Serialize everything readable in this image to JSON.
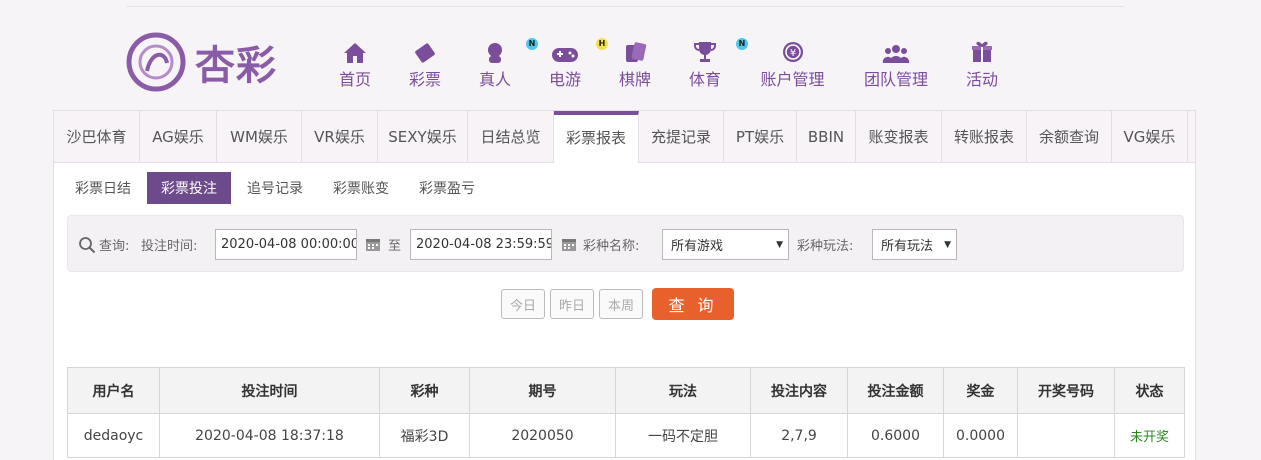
{
  "logo": {
    "text": "杏彩"
  },
  "nav": [
    {
      "label": "首页",
      "icon": "home-icon"
    },
    {
      "label": "彩票",
      "icon": "lottery-ticket-icon"
    },
    {
      "label": "真人",
      "icon": "live-dealer-icon",
      "badge": "N"
    },
    {
      "label": "电游",
      "icon": "gamepad-icon",
      "badge": "H"
    },
    {
      "label": "棋牌",
      "icon": "cards-icon"
    },
    {
      "label": "体育",
      "icon": "trophy-icon",
      "badge": "N"
    },
    {
      "label": "账户管理",
      "icon": "yen-coin-icon"
    },
    {
      "label": "团队管理",
      "icon": "team-icon"
    },
    {
      "label": "活动",
      "icon": "gift-icon"
    }
  ],
  "tabs": [
    "沙巴体育",
    "AG娱乐",
    "WM娱乐",
    "VR娱乐",
    "SEXY娱乐",
    "日结总览",
    "彩票报表",
    "充提记录",
    "PT娱乐",
    "BBIN",
    "账变报表",
    "转账报表",
    "余额查询",
    "VG娱乐"
  ],
  "active_tab": "彩票报表",
  "subtabs": [
    "彩票日结",
    "彩票投注",
    "追号记录",
    "彩票账变",
    "彩票盈亏"
  ],
  "active_subtab": "彩票投注",
  "query": {
    "label": "查询:",
    "time_label": "投注时间:",
    "start": "2020-04-08 00:00:00",
    "to": "至",
    "end": "2020-04-08 23:59:59",
    "game_label": "彩种名称:",
    "game_value": "所有游戏",
    "play_label": "彩种玩法:",
    "play_value": "所有玩法"
  },
  "quick": {
    "today": "今日",
    "yesterday": "昨日",
    "week": "本周",
    "search": "查 询"
  },
  "table": {
    "headers": [
      "用户名",
      "投注时间",
      "彩种",
      "期号",
      "玩法",
      "投注内容",
      "投注金额",
      "奖金",
      "开奖号码",
      "状态"
    ],
    "rows": [
      [
        "dedaoyc",
        "2020-04-08 18:37:18",
        "福彩3D",
        "2020050",
        "一码不定胆",
        "2,7,9",
        "0.6000",
        "0.0000",
        "",
        "未开奖"
      ]
    ]
  },
  "colors": {
    "accent": "#7b4e9c",
    "subtab_active": "#6c4a8c",
    "search_button": "#e8612d",
    "status_pending": "#2a8a1c"
  }
}
